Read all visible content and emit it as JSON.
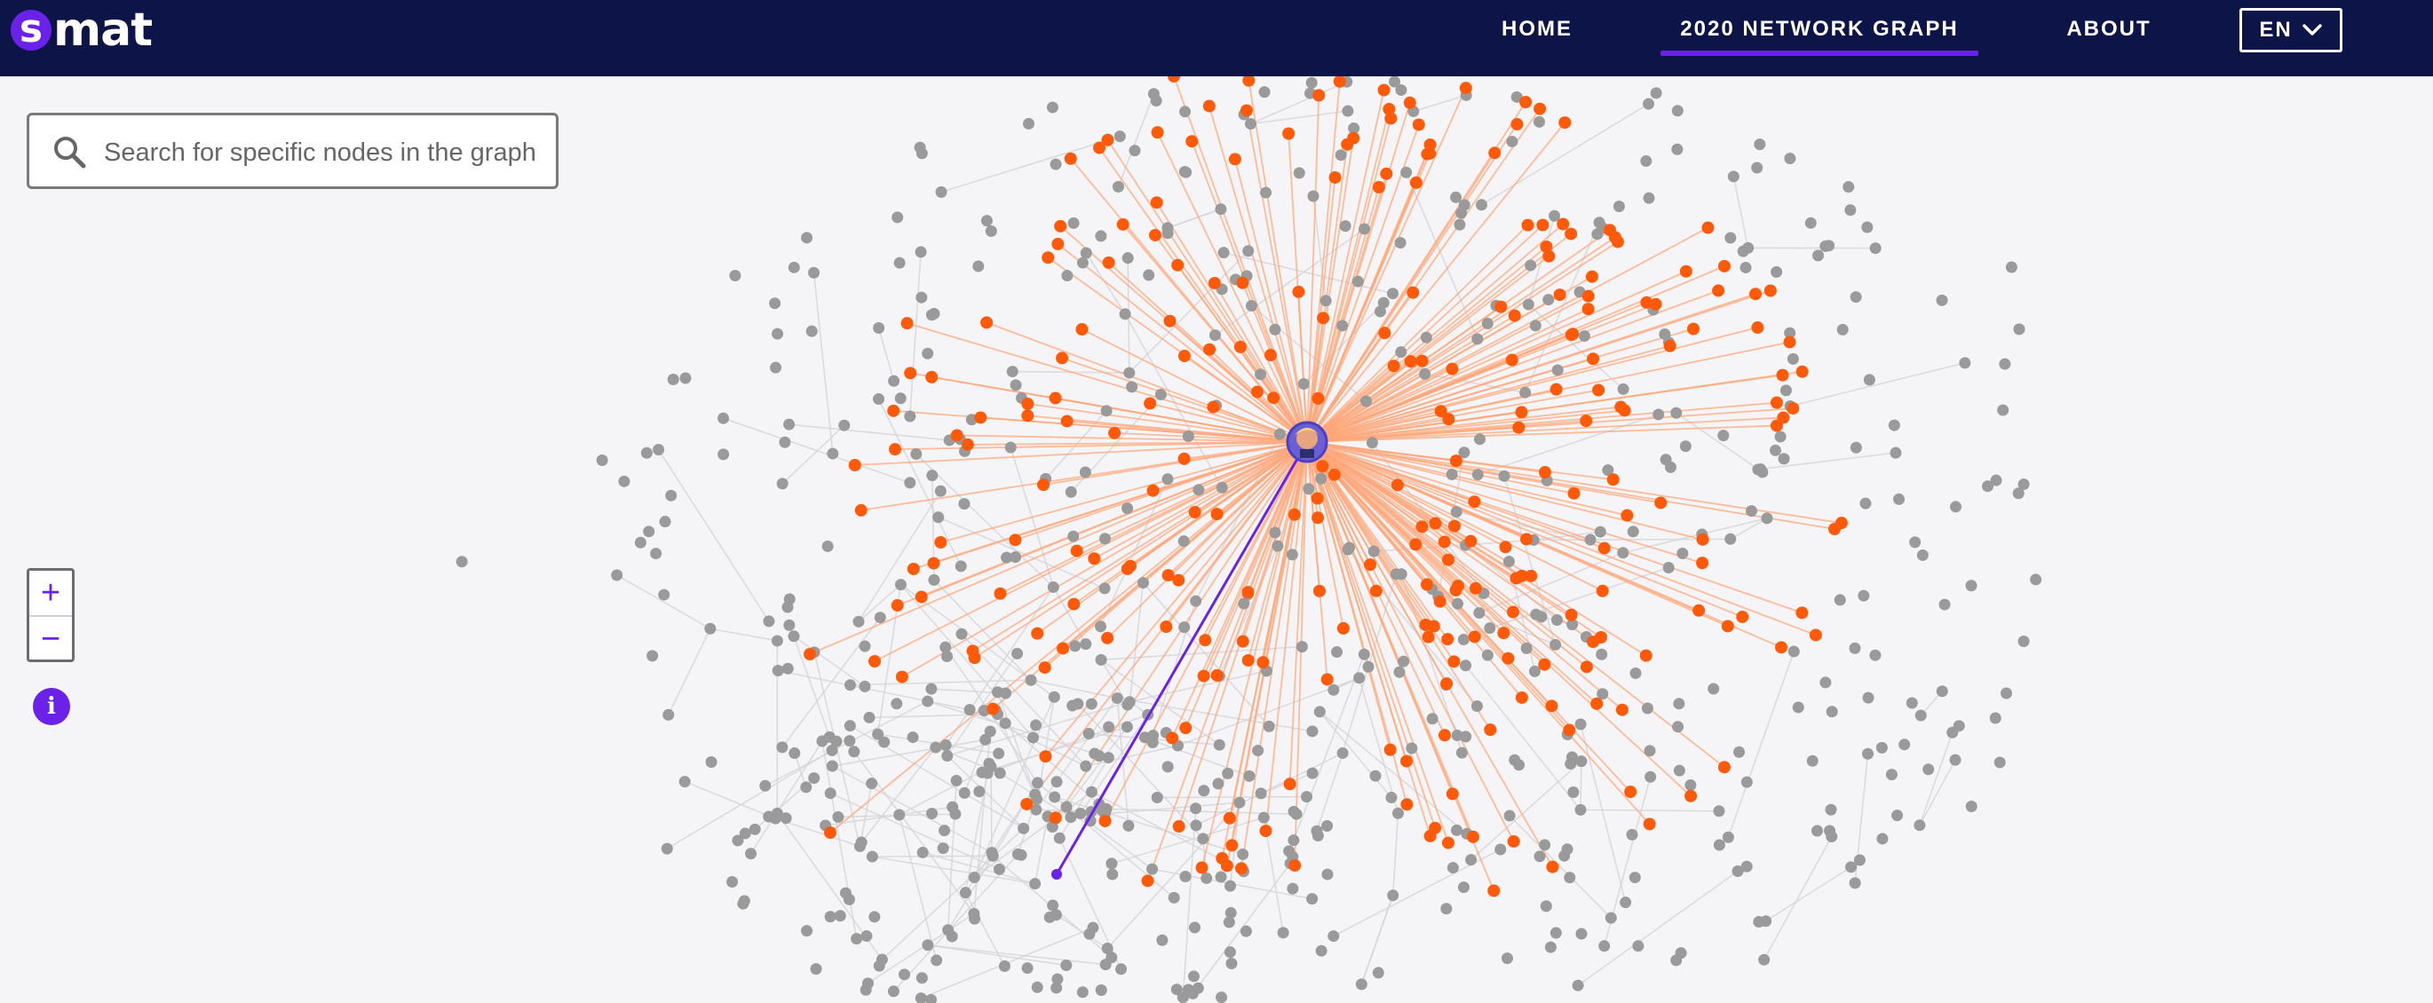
{
  "app": {
    "logo_letter": "s",
    "logo_text": "mat"
  },
  "nav": {
    "items": [
      {
        "label": "HOME",
        "active": false
      },
      {
        "label": "2020 NETWORK GRAPH",
        "active": true
      },
      {
        "label": "ABOUT",
        "active": false
      }
    ],
    "language": "EN"
  },
  "search": {
    "placeholder": "Search for specific nodes in the graph",
    "value": ""
  },
  "zoom": {
    "in_label": "+",
    "out_label": "−"
  },
  "info": {
    "label": "i"
  },
  "colors": {
    "nav_bg": "#0d1447",
    "accent": "#6a22e8",
    "highlight_node": "#ff5a0a",
    "highlight_edge": "#ffa77a",
    "default_node": "#9a9a9a",
    "default_edge": "#d4d4d8",
    "background": "#f5f5f7"
  },
  "icons": [
    "search-icon",
    "plus-icon",
    "minus-icon",
    "info-icon",
    "chevron-down-icon",
    "avatar-icon"
  ]
}
